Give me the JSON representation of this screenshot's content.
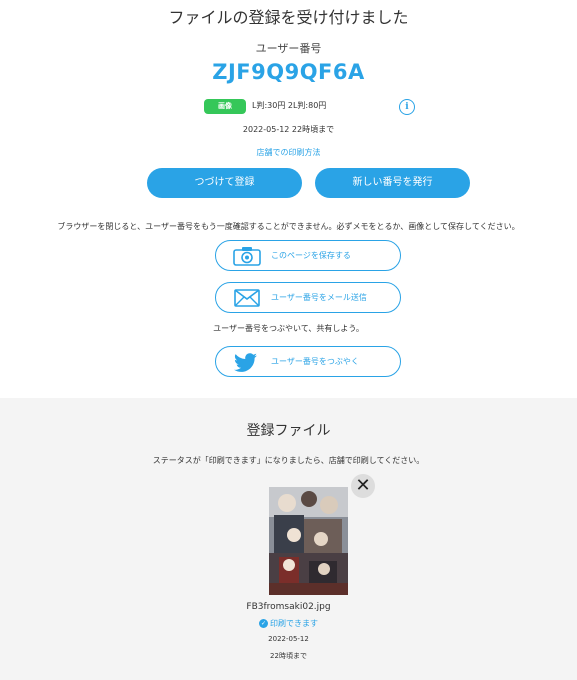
{
  "header": {
    "title": "ファイルの登録を受け付けました"
  },
  "user": {
    "label": "ユーザー番号",
    "code": "ZJF9Q9QF6A"
  },
  "price_info": {
    "badge": "画像",
    "prices": "L判:30円 2L判:80円",
    "info_icon": "info-icon"
  },
  "deadline": "2022-05-12 22時頃まで",
  "howto_link": "店舗での印刷方法",
  "buttons": {
    "continue": "つづけて登録",
    "new_number": "新しい番号を発行"
  },
  "warning": "ブラウザーを閉じると、ユーザー番号をもう一度確認することができません。必ずメモをとるか、画像として保存してください。",
  "actions": {
    "save_page": "このページを保存する",
    "email": "ユーザー番号をメール送信",
    "share_note": "ユーザー番号をつぶやいて、共有しよう。",
    "tweet": "ユーザー番号をつぶやく"
  },
  "registered": {
    "title": "登録ファイル",
    "note": "ステータスが「印刷できます」になりましたら、店舗で印刷してください。",
    "file": {
      "name": "FB3fromsaki02.jpg",
      "status": "印刷できます",
      "date": "2022-05-12",
      "time": "22時頃まで"
    }
  },
  "colors": {
    "accent": "#2aa3e6",
    "badge": "#35c759",
    "bottom_bg": "#f4f4f4"
  }
}
